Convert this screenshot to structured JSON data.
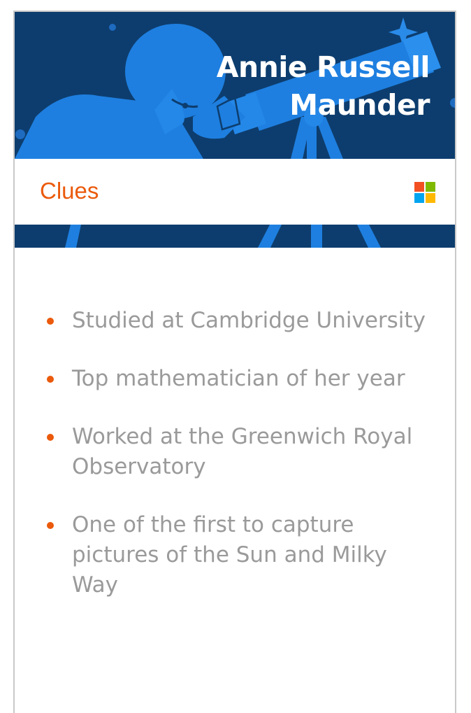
{
  "header": {
    "title_line1": "Annie Russell",
    "title_line2": "Maunder",
    "illustration": "astronomer-with-telescope"
  },
  "clues": {
    "label": "Clues",
    "logo": "microsoft-logo",
    "items": [
      "Studied at Cambridge University",
      "Top mathematician of her year",
      "Worked at the Greenwich Royal Observatory",
      "One of the first to capture pictures of the Sun and Milky Way"
    ]
  },
  "colors": {
    "header_bg": "#0d3d6e",
    "illustration_blue": "#1e7fe0",
    "accent_orange": "#eb5a0c",
    "clue_text": "#9a9a9a",
    "logo_red": "#f25022",
    "logo_green": "#7fba00",
    "logo_blue": "#00a4ef",
    "logo_yellow": "#ffb900"
  }
}
